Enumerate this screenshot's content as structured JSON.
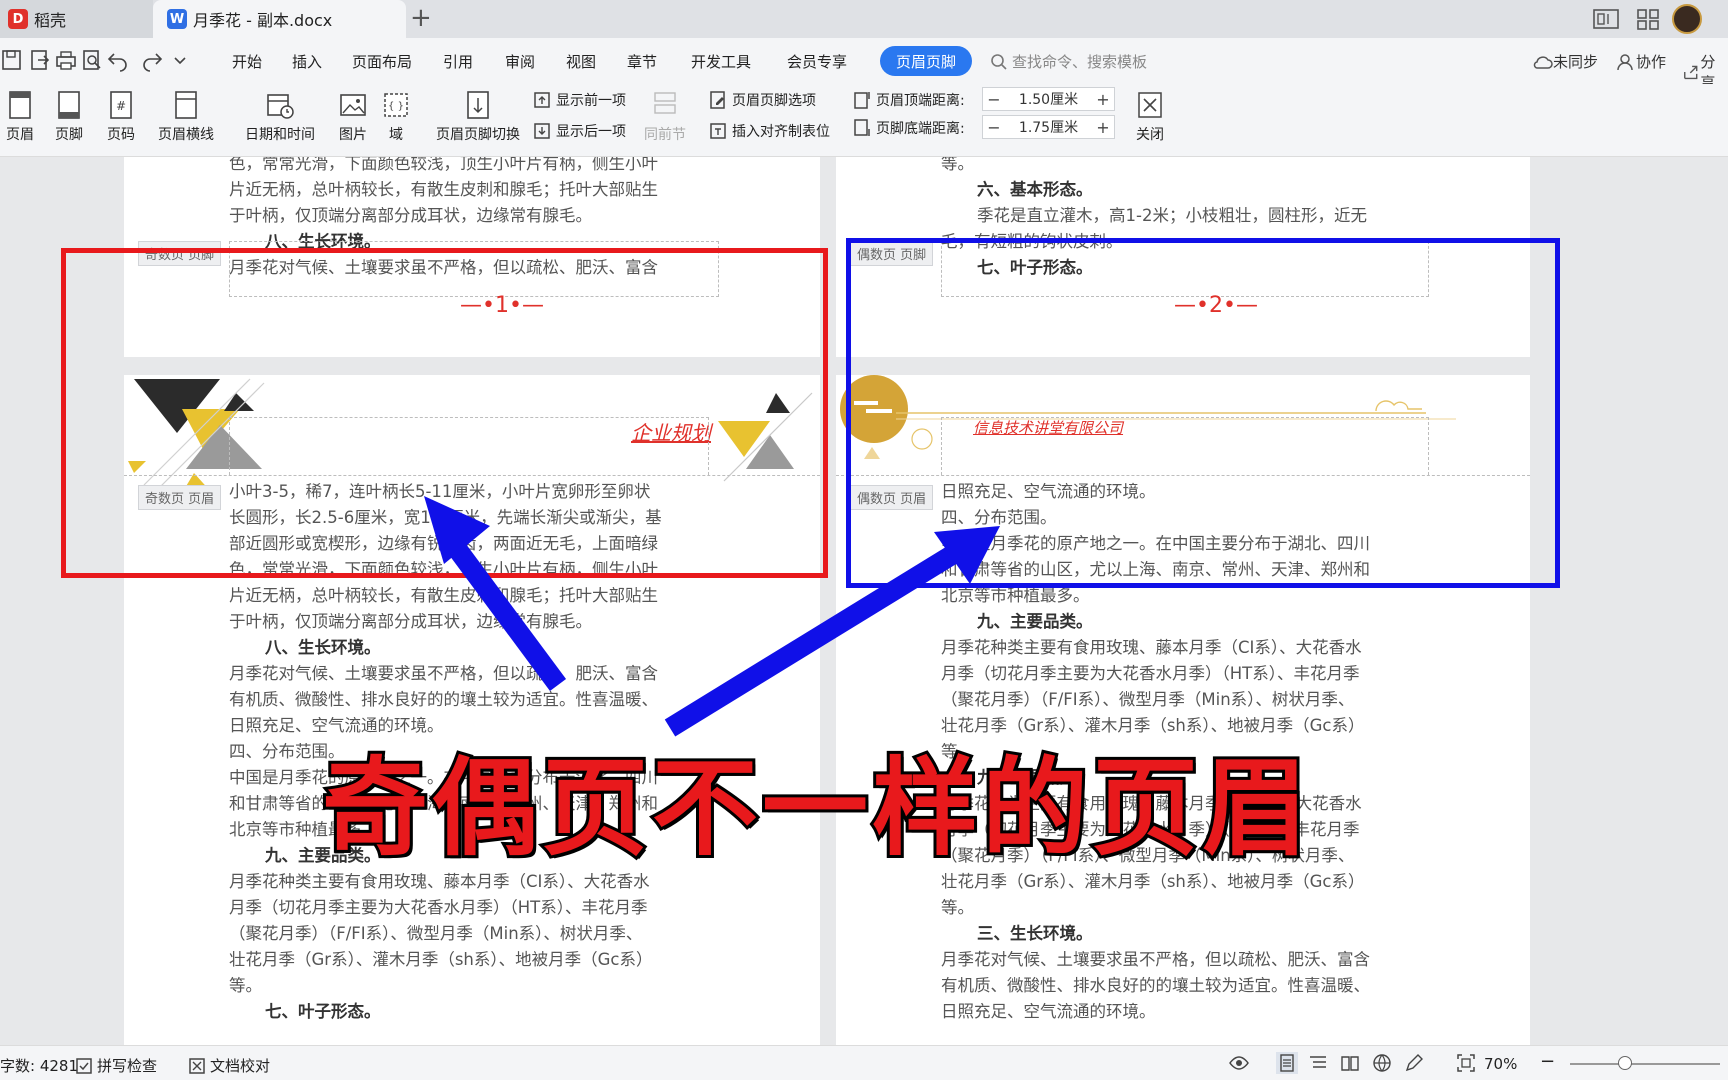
{
  "tabs": {
    "home": "稻壳",
    "doc": "月季花 - 副本.docx",
    "close": "×",
    "new": "+"
  },
  "menu": {
    "items": [
      "开始",
      "插入",
      "页面布局",
      "引用",
      "审阅",
      "视图",
      "章节",
      "开发工具",
      "会员专享"
    ],
    "active": "页眉页脚",
    "search": "查找命令、搜索模板",
    "sync": "未同步",
    "collab": "协作",
    "share": "分享"
  },
  "ribbon": {
    "header": "页眉",
    "footer": "页脚",
    "page_num": "页码",
    "header_line": "页眉横线",
    "datetime": "日期和时间",
    "picture": "图片",
    "field": "域",
    "switch": "页眉页脚切换",
    "show_prev": "显示前一项",
    "show_next": "显示后一项",
    "same_prev": "同前节",
    "options": "页眉页脚选项",
    "insert_tab": "插入对齐制表位",
    "top_dist_label": "页眉顶端距离:",
    "top_dist_value": "1.50厘米",
    "bottom_dist_label": "页脚底端距离:",
    "bottom_dist_value": "1.75厘米",
    "close": "关闭",
    "minus": "−",
    "plus": "+"
  },
  "page1": {
    "top_lines": [
      "色，常常光滑，下面颜色较浅，顶生小叶片有柄，侧生小叶",
      "片近无柄，总叶柄较长，有散生皮刺和腺毛；托叶大部贴生",
      "于叶柄，仅顶端分离部分成耳状，边缘常有腺毛。"
    ],
    "top_heading": "八、生长环境。",
    "top_last": "月季花对气候、土壤要求虽不严格，但以疏松、肥沃、富含",
    "footer_tag": "奇数页 页脚",
    "page_number": "—•1•—",
    "header_tag": "奇数页 页眉",
    "header_text": "企业规划",
    "lines": [
      "小叶3-5，稀7，连叶柄长5-11厘米，小叶片宽卵形至卵状",
      "长圆形，长2.5-6厘米，宽1-3厘米，先端长渐尖或渐尖，基",
      "部近圆形或宽楔形，边缘有锐锯齿，两面近无毛，上面暗绿",
      "色，常常光滑，下面颜色较浅，顶生小叶片有柄，侧生小叶",
      "片近无柄，总叶柄较长，有散生皮刺和腺毛；托叶大部贴生",
      "于叶柄，仅顶端分离部分成耳状，边缘常有腺毛。"
    ],
    "heading1": "八、生长环境。",
    "lines2": [
      "月季花对气候、土壤要求虽不严格，但以疏松、肥沃、富含",
      "有机质、微酸性、排水良好的的壤土较为适宜。性喜温暖、",
      "日照充足、空气流通的环境。",
      "四、分布范围。",
      "中国是月季花的原产地之一。在中国主要分布于湖北、四川",
      "和甘肃等省的山区，尤以上海、南京、常州、天津、郑州和",
      "北京等市种植最多。"
    ],
    "heading2": "九、主要品类。",
    "lines3": [
      "月季花种类主要有食用玫瑰、藤本月季（CI系）、大花香水",
      "月季（切花月季主要为大花香水月季）（HT系）、丰花月季",
      "（聚花月季）（F/FI系）、微型月季（Min系）、树状月季、",
      "壮花月季（Gr系）、灌木月季（sh系）、地被月季（Gc系）",
      "等。"
    ],
    "heading3": "七、叶子形态。"
  },
  "page2": {
    "top_lines": [
      "等。"
    ],
    "top_heading": "六、基本形态。",
    "top_line2": "季花是直立灌木，高1-2米；小枝粗壮，圆柱形，近无",
    "top_line3": "毛，有短粗的钩状皮刺。",
    "top_heading2": "七、叶子形态。",
    "footer_tag": "偶数页 页脚",
    "page_number": "—•2•—",
    "header_tag": "偶数页 页眉",
    "header_text": "信息技术讲堂有限公司",
    "lines": [
      "日照充足、空气流通的环境。",
      "四、分布范围。",
      "中国是月季花的原产地之一。在中国主要分布于湖北、四川",
      "和甘肃等省的山区，尤以上海、南京、常州、天津、郑州和",
      "北京等市种植最多。"
    ],
    "heading1": "九、主要品类。",
    "lines2": [
      "月季花种类主要有食用玫瑰、藤本月季（CI系）、大花香水",
      "月季（切花月季主要为大花香水月季）（HT系）、丰花月季",
      "（聚花月季）（F/FI系）、微型月季（Min系）、树状月季、",
      "壮花月季（Gr系）、灌木月季（sh系）、地被月季（Gc系）",
      "等。"
    ],
    "heading2": "九、主要品类。",
    "lines3": [
      "月季花种类主要有食用玫瑰、藤本月季（CI系）、大花香水",
      "月季（切花月季主要为大花香水月季）（HT系）、丰花月季",
      "（聚花月季）（F/FI系）、微型月季（Min系）、树状月季、",
      "壮花月季（Gr系）、灌木月季（sh系）、地被月季（Gc系）",
      "等。"
    ],
    "heading3": "三、生长环境。",
    "lines4": [
      "月季花对气候、土壤要求虽不严格，但以疏松、肥沃、富含",
      "有机质、微酸性、排水良好的的壤土较为适宜。性喜温暖、",
      "日照充足、空气流通的环境。"
    ]
  },
  "caption": "奇偶页不一样的页眉",
  "status": {
    "word_count": "字数: 4281",
    "spell": "拼写检查",
    "proof": "文档校对",
    "zoom": "70%",
    "minus": "−"
  },
  "colors": {
    "accent": "#2a78f0",
    "red": "#e8191c",
    "blue": "#1010e8",
    "header_red": "#e0312b"
  }
}
